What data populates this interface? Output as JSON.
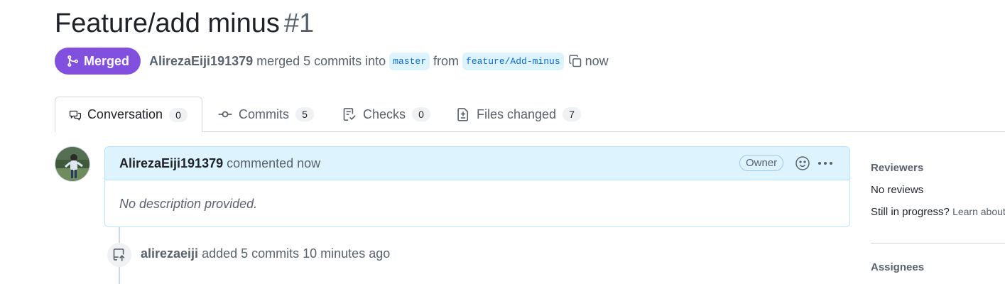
{
  "pr": {
    "title": "Feature/add minus",
    "number": "#1",
    "state": "Merged",
    "author": "AlirezaEiji191379",
    "action_text": "merged 5 commits into",
    "base_branch": "master",
    "from_text": "from",
    "head_branch": "feature/Add-minus",
    "time": "now"
  },
  "tabs": [
    {
      "label": "Conversation",
      "count": "0",
      "icon": "comment-discussion-icon"
    },
    {
      "label": "Commits",
      "count": "5",
      "icon": "git-commit-icon"
    },
    {
      "label": "Checks",
      "count": "0",
      "icon": "checklist-icon"
    },
    {
      "label": "Files changed",
      "count": "7",
      "icon": "file-diff-icon"
    }
  ],
  "comment": {
    "author": "AlirezaEiji191379",
    "action": "commented now",
    "badge": "Owner",
    "body": "No description provided."
  },
  "event": {
    "author": "alirezaeiji",
    "text": "added 5 commits 10 minutes ago"
  },
  "sidebar": {
    "reviewers_heading": "Reviewers",
    "no_reviews": "No reviews",
    "still_in_progress": "Still in progress?",
    "learn_about": "Learn about",
    "assignees_heading": "Assignees"
  },
  "colors": {
    "merged": "#8250df",
    "link": "#0969da",
    "branch_bg": "#ddf4ff",
    "comment_header_bg": "#ddf4ff"
  }
}
